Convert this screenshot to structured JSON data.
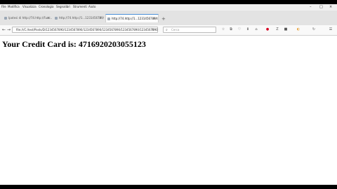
{
  "menubar": {
    "items": [
      "File",
      "Modifica",
      "Visualizza",
      "Cronologia",
      "Segnalibri",
      "Strumenti",
      "Aiuto"
    ],
    "minimize": "–",
    "maximize": "□",
    "close": "×"
  },
  "tabs": [
    {
      "label": "Ipotesi di http://74.http://Fuoc..."
    },
    {
      "label": "http://74.http://1...1231456789/test"
    },
    {
      "label": "http://74.http://1...1231456789/test"
    }
  ],
  "tab_close": "×",
  "new_tab": "+",
  "nav": {
    "back": "←",
    "forward": "→",
    "url": "file:///C:/test/Posts/D/1234567890/1234567890/1234567890/1234567890/1234567890/1234567890",
    "reload": "⟳",
    "search_placeholder": "Cerca",
    "search_icon": "⌕"
  },
  "toolbar_icons": [
    "☆",
    "⧉",
    "♡",
    "⬇",
    "⌂",
    "●",
    "Z",
    "■",
    "◐",
    "↻",
    "☰"
  ],
  "page": {
    "heading": "Your Credit Card is: 4716920203055123"
  }
}
